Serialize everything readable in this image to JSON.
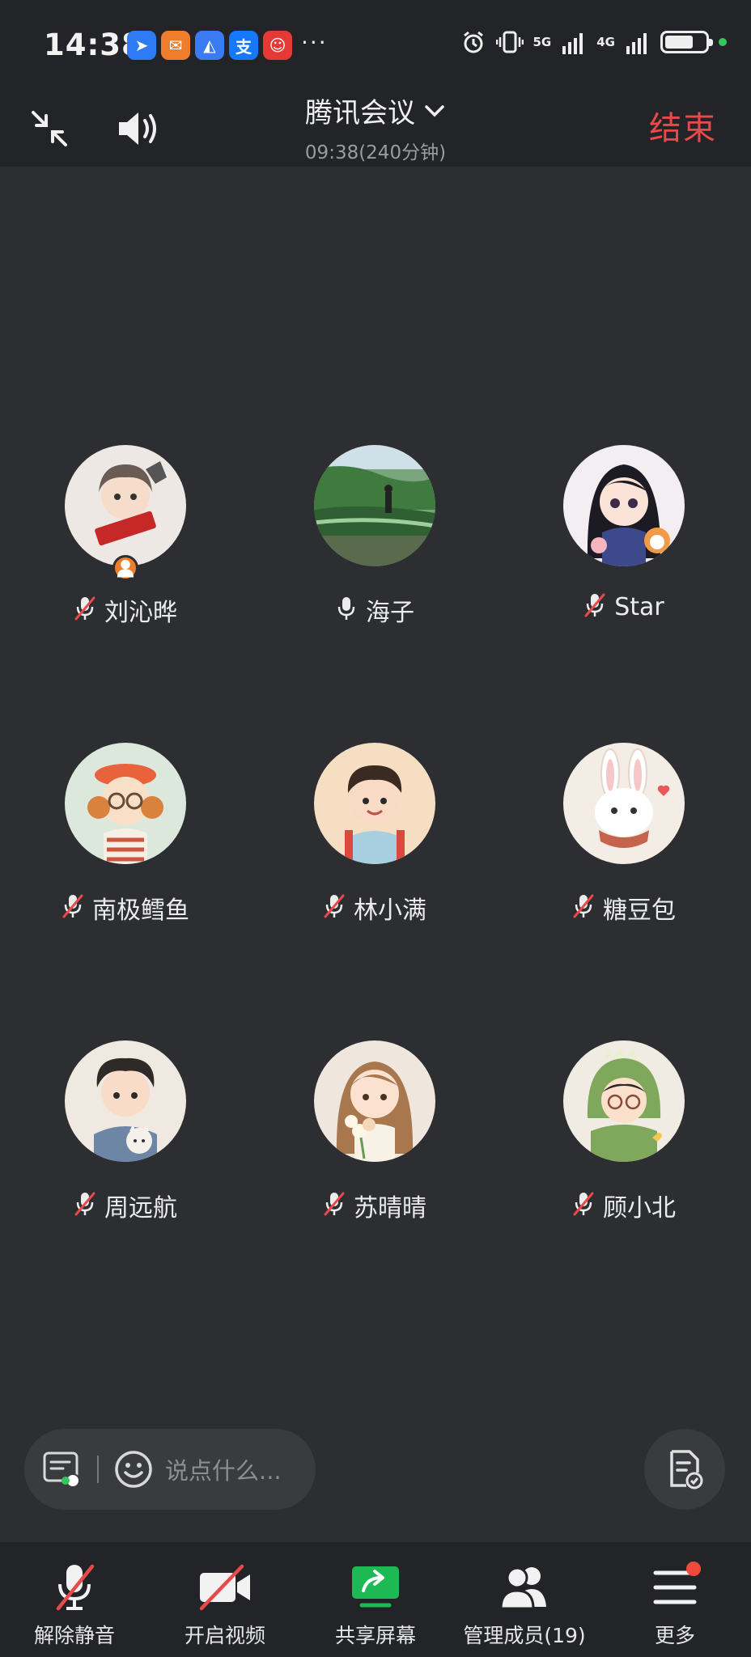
{
  "status_bar": {
    "time": "14:38",
    "app_icons": [
      {
        "name": "feishu-app-icon",
        "glyph": "➤",
        "color": "#2f7bf5"
      },
      {
        "name": "red-envelope-app-icon",
        "glyph": "✉",
        "color": "#f07d2b"
      },
      {
        "name": "tencent-meeting-app-icon",
        "glyph": "◭",
        "color": "#3a7af2"
      },
      {
        "name": "alipay-app-icon",
        "glyph": "支",
        "color": "#1677ff"
      },
      {
        "name": "clown-app-icon",
        "glyph": "☺",
        "color": "#e53935"
      }
    ],
    "overflow": "···",
    "network_5g": "5G",
    "network_4g": "4G",
    "battery_level": 0.7
  },
  "header": {
    "title": "腾讯会议",
    "duration": "09:38(240分钟)",
    "end_label": "结束"
  },
  "participants": [
    {
      "name": "刘沁晔",
      "mic": "muted",
      "host": true,
      "avatar": "girl-with-red-banner"
    },
    {
      "name": "海子",
      "mic": "on",
      "host": false,
      "avatar": "green-landscape-photo"
    },
    {
      "name": "Star",
      "mic": "muted",
      "host": false,
      "avatar": "anime-girl-with-cat"
    },
    {
      "name": "南极鳕鱼",
      "mic": "muted",
      "host": false,
      "avatar": "girl-with-red-beret"
    },
    {
      "name": "林小满",
      "mic": "muted",
      "host": false,
      "avatar": "boy-with-backpack"
    },
    {
      "name": "糖豆包",
      "mic": "muted",
      "host": false,
      "avatar": "bunny-with-scarf"
    },
    {
      "name": "周远航",
      "mic": "muted",
      "host": false,
      "avatar": "boy-with-cat"
    },
    {
      "name": "苏晴晴",
      "mic": "muted",
      "host": false,
      "avatar": "girl-with-flowers"
    },
    {
      "name": "顾小北",
      "mic": "muted",
      "host": false,
      "avatar": "boy-in-dinosaur-hoodie"
    }
  ],
  "chat": {
    "placeholder": "说点什么..."
  },
  "toolbar": {
    "unmute": "解除静音",
    "video": "开启视频",
    "share": "共享屏幕",
    "members": "管理成员(19)",
    "more": "更多"
  },
  "colors": {
    "accent_red": "#e84a4a",
    "share_green": "#1db954",
    "host_badge": "#f07d2b",
    "background": "#2d2e31"
  }
}
